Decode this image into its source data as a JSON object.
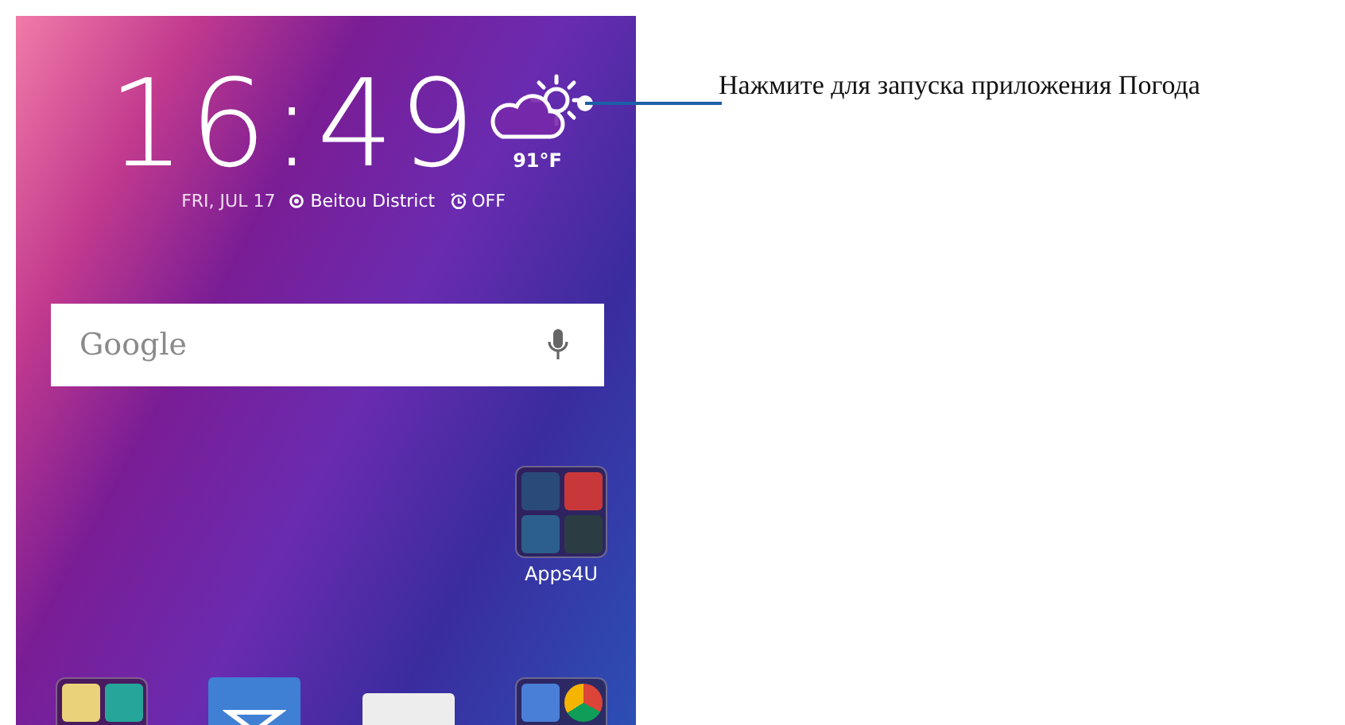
{
  "home_screen": {
    "clock": {
      "time": "16:49"
    },
    "weather": {
      "temperature": "91°F"
    },
    "date": "FRI, JUL 17",
    "location": "Beitou District",
    "alarm": "OFF",
    "search_bar": {
      "placeholder": "Google"
    },
    "folders": [
      {
        "label": "Apps4U"
      }
    ]
  },
  "callout": {
    "text": "Нажмите для запуска приложения Погода"
  }
}
